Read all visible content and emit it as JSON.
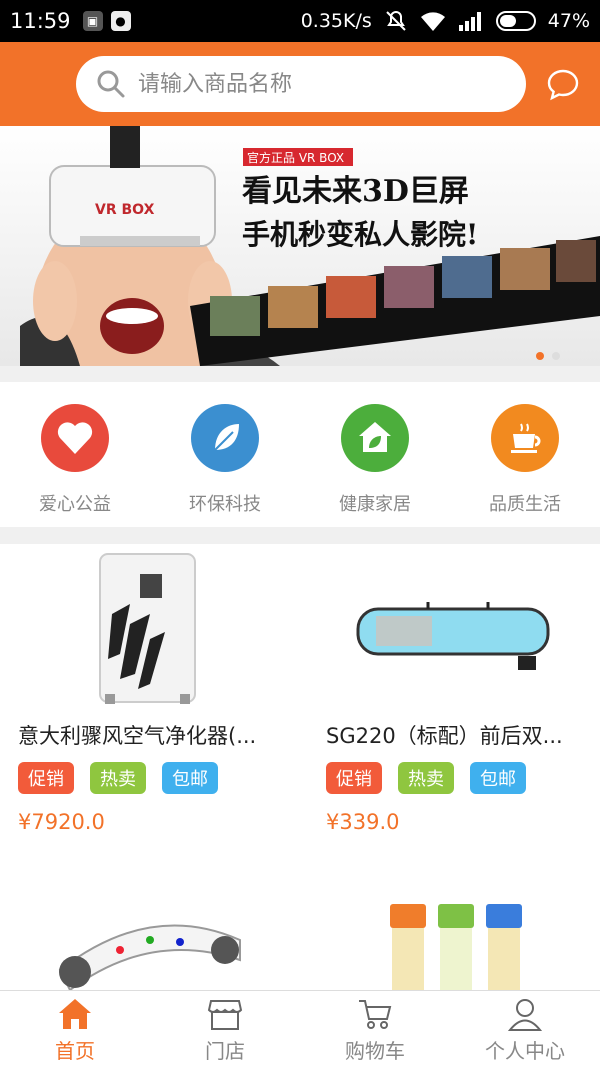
{
  "status_bar": {
    "time": "11:59",
    "network_speed": "0.35K/s",
    "battery": "47%"
  },
  "search": {
    "placeholder": "请输入商品名称"
  },
  "banner": {
    "badge": "官方正品 VR BOX",
    "headline_1": "看见未来3D巨屏",
    "headline_2": "手机秒变私人影院!",
    "product_name": "VR BOX"
  },
  "categories": [
    {
      "label": "爱心公益",
      "color": "#e84a3c",
      "icon": "heart-icon"
    },
    {
      "label": "环保科技",
      "color": "#3b8fd0",
      "icon": "leaf-plug-icon"
    },
    {
      "label": "健康家居",
      "color": "#4cae3c",
      "icon": "home-leaf-icon"
    },
    {
      "label": "品质生活",
      "color": "#f28a1f",
      "icon": "coffee-cup-icon"
    }
  ],
  "products": [
    {
      "title": "意大利骤风空气净化器(...",
      "tags": [
        "促销",
        "热卖",
        "包邮"
      ],
      "price": "¥7920.0"
    },
    {
      "title": "SG220（标配）前后双...",
      "tags": [
        "促销",
        "热卖",
        "包邮"
      ],
      "price": "¥339.0"
    }
  ],
  "tabbar": {
    "items": [
      {
        "label": "首页",
        "icon": "home-icon",
        "active": true
      },
      {
        "label": "门店",
        "icon": "store-icon",
        "active": false
      },
      {
        "label": "购物车",
        "icon": "cart-icon",
        "active": false
      },
      {
        "label": "个人中心",
        "icon": "user-icon",
        "active": false
      }
    ]
  },
  "colors": {
    "accent": "#f27229",
    "promo_tag": "#f25b3a",
    "hot_tag": "#8fc63f",
    "ship_tag": "#3fb0ee"
  }
}
